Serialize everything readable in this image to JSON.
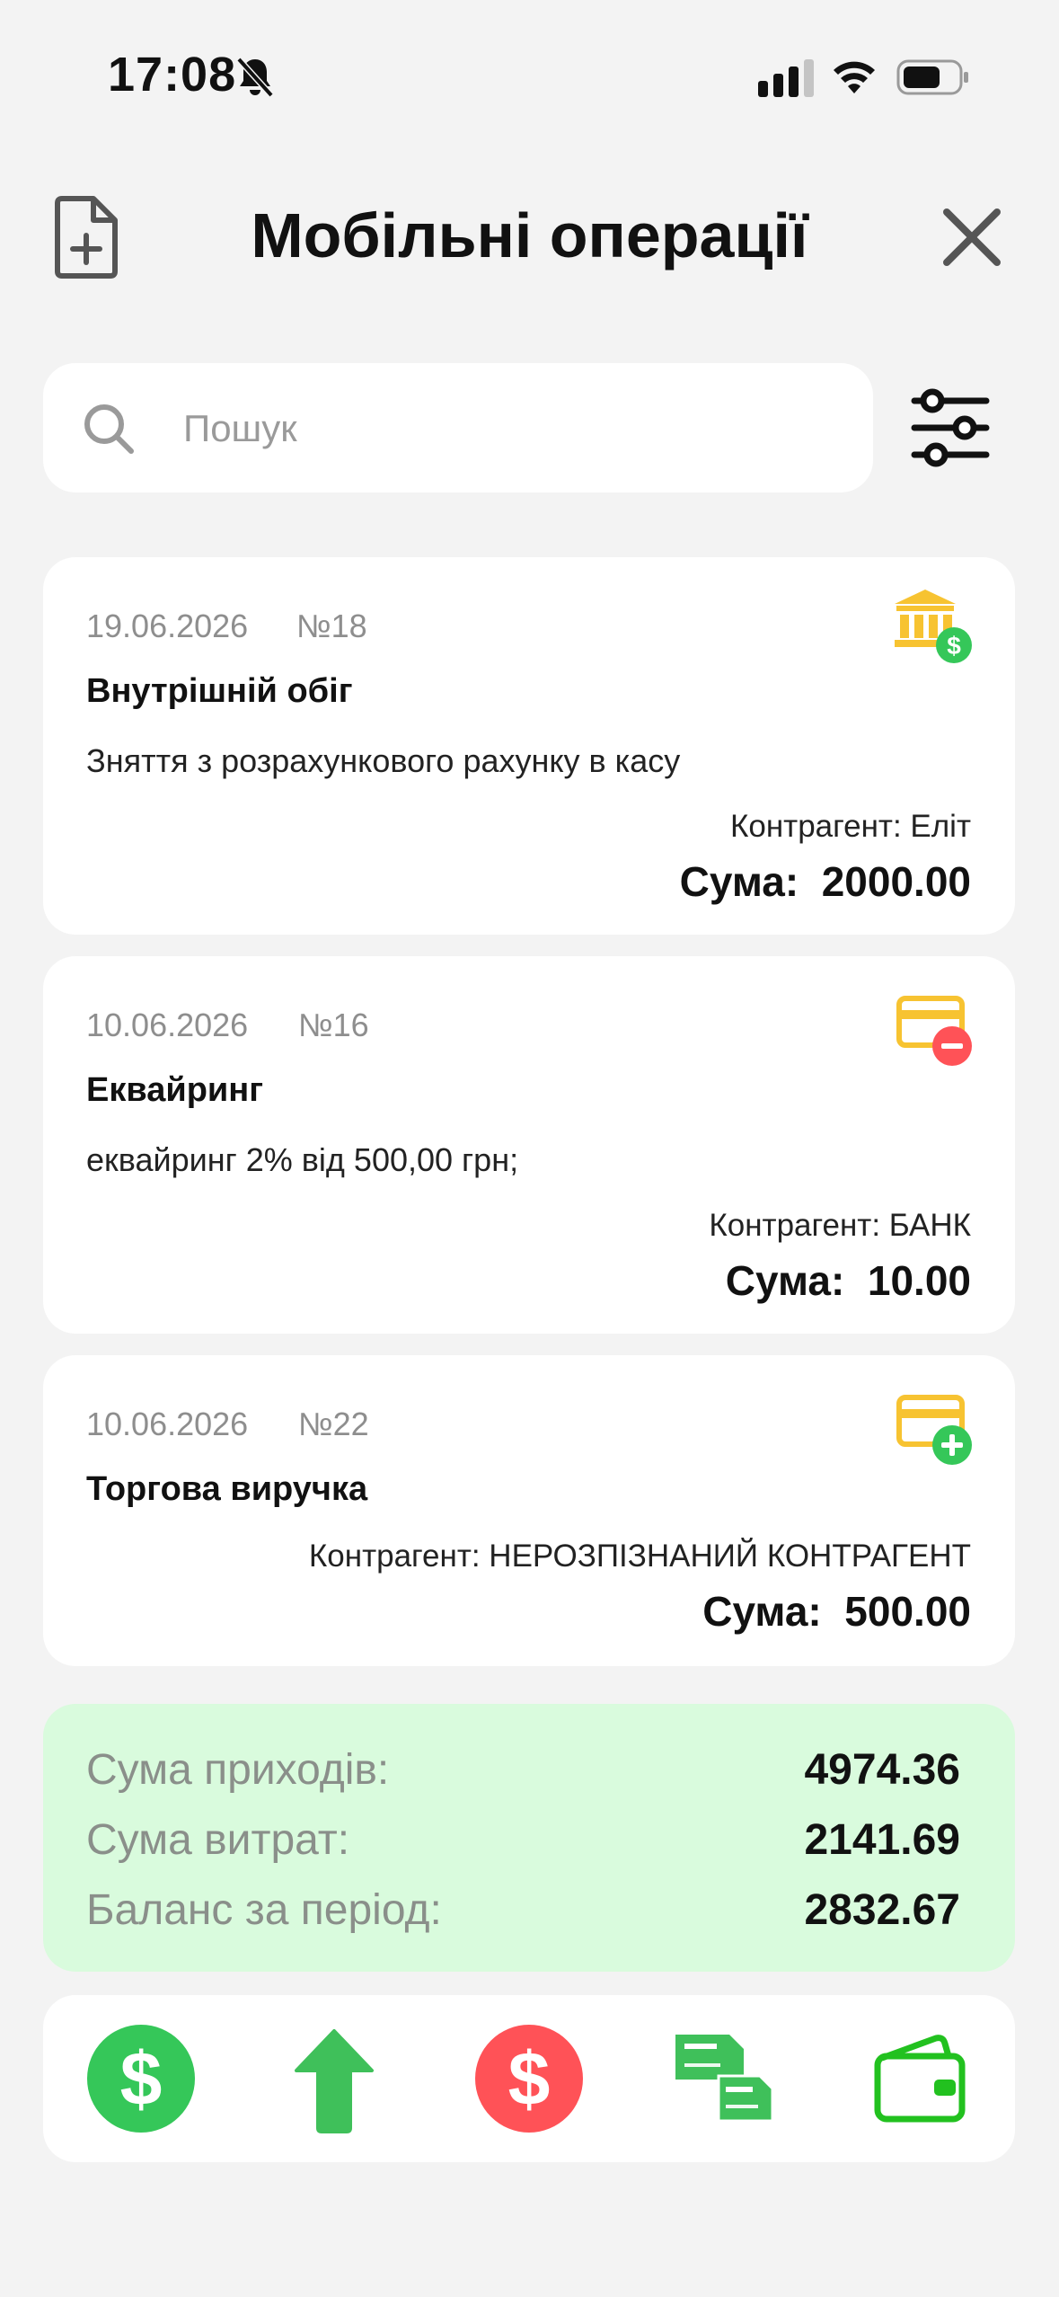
{
  "status": {
    "time": "17:08"
  },
  "header": {
    "title": "Мобільні операції"
  },
  "search": {
    "placeholder": "Пошук"
  },
  "operations": [
    {
      "date": "19.06.2026",
      "number": "№18",
      "title": "Внутрішній обіг",
      "description": "Зняття з розрахункового рахунку в касу",
      "counterparty": "Контрагент: Еліт",
      "sum": "Сума:  2000.00",
      "icon": "bank-dollar-icon"
    },
    {
      "date": "10.06.2026",
      "number": "№16",
      "title": "Еквайринг",
      "description": "еквайринг 2% від 500,00 грн;",
      "counterparty": "Контрагент: БАНК",
      "sum": "Сума:  10.00",
      "icon": "card-minus-icon"
    },
    {
      "date": "10.06.2026",
      "number": "№22",
      "title": "Торгова виручка",
      "counterparty": "Контрагент: НЕРОЗПІЗНАНИЙ КОНТРАГЕНТ",
      "sum": "Сума:  500.00",
      "icon": "card-plus-icon"
    }
  ],
  "summary": {
    "income_label": "Сума приходів:",
    "income_value": "4974.36",
    "expense_label": "Сума витрат:",
    "expense_value": "2141.69",
    "balance_label": "Баланс за період:",
    "balance_value": "2832.67"
  },
  "bottom_bar": [
    "income-dollar-icon",
    "arrow-up-icon",
    "expense-dollar-icon",
    "transfer-documents-icon",
    "wallet-icon"
  ],
  "colors": {
    "green": "#35c759",
    "red": "#ff5257",
    "yellow": "#f7c331",
    "summary_bg": "#d9fbdd"
  }
}
